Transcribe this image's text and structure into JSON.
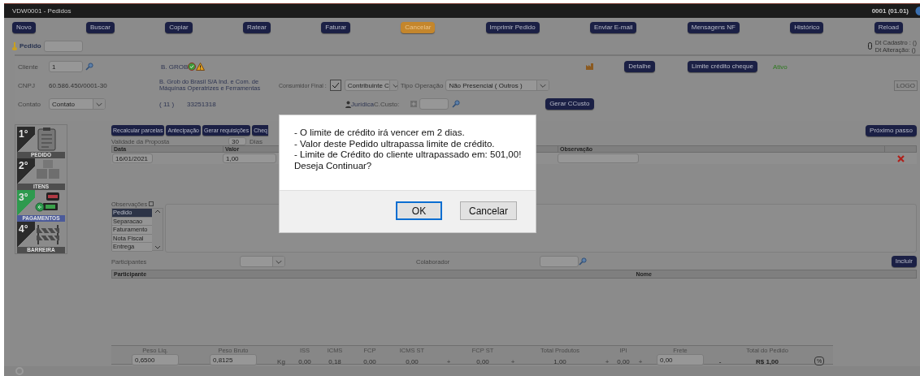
{
  "window": {
    "title": "VDW0001 - Pedidos",
    "version": "0001 (01.01)"
  },
  "toolbar": [
    {
      "label": "Novo",
      "kind": "normal"
    },
    {
      "label": "Buscar",
      "kind": "normal"
    },
    {
      "label": "Copiar",
      "kind": "normal"
    },
    {
      "label": "Ratear",
      "kind": "normal"
    },
    {
      "label": "Faturar",
      "kind": "normal"
    },
    {
      "label": "Cancelar",
      "kind": "warning"
    },
    {
      "label": "Imprimir Pedido",
      "kind": "normal"
    },
    {
      "label": "Enviar E-mail",
      "kind": "normal"
    },
    {
      "label": "Mensagens NF",
      "kind": "normal"
    },
    {
      "label": "Histórico",
      "kind": "normal"
    },
    {
      "label": "Reload",
      "kind": "normal"
    }
  ],
  "order": {
    "label": "Pedido",
    "created": "Dt Cadastro : ()",
    "changed": "Dt Alteração: ()"
  },
  "client": {
    "cliente_label": "Cliente",
    "cliente_value": "1",
    "short_name": "B. GROB",
    "cnpj_label": "CNPJ",
    "cnpj": "60.586.450/0001-30",
    "company_name": "B. Grob do Brasil S/A Ind. e Com. de Máquinas Operatrizes e Ferramentas",
    "contato_label": "Contato",
    "contato_value": "Contato",
    "phone_area": "(  11  )",
    "phone": "33251318",
    "consumidor_label": "Consumidor Final :",
    "consumidor_checked": true,
    "contribuinte": "Contribuinte C",
    "tipo_label": "Tipo Operação",
    "tipo_value": "Não Presencial ( Outros )",
    "person_type": "Jurídica",
    "ccusto_label": "C.Custo:",
    "detail_button": "Detalhe",
    "credit_button": "Limite crédito cheque",
    "status": "Ativo",
    "gerar_button": "Gerar CCusto",
    "logo": "LOGO"
  },
  "steps": [
    {
      "number": "1°",
      "label": "PEDIDO",
      "kind": "clipboard",
      "selected": false
    },
    {
      "number": "2°",
      "label": "ITENS",
      "kind": "boxes",
      "selected": false
    },
    {
      "number": "3°",
      "label": "PAGAMENTOS",
      "kind": "payment",
      "selected": true
    },
    {
      "number": "4°",
      "label": "BARREIRA",
      "kind": "barrier",
      "selected": false
    }
  ],
  "payment_buttons": [
    "Recalcular parcelas",
    "Antecipação",
    "Gerar requisições",
    "Cheq"
  ],
  "next_button": "Próximo passo",
  "validity": {
    "label": "Validade da Proposta",
    "value": "30",
    "unit": "Dias"
  },
  "installments": {
    "columns": [
      "Data",
      "Valor",
      "Observação"
    ],
    "rows": [
      {
        "data": "16/01/2021",
        "valor": "1,00"
      }
    ]
  },
  "observations": {
    "label": "Observações",
    "items": [
      {
        "label": "Pedido",
        "selected": true
      },
      {
        "label": "Separacao",
        "selected": false
      },
      {
        "label": "Faturamento",
        "selected": false
      },
      {
        "label": "Nota Fiscal",
        "selected": false
      },
      {
        "label": "Entrega",
        "selected": false
      }
    ]
  },
  "participants": {
    "label": "Participantes",
    "colaborador_label": "Colaborador",
    "include_button": "Incluir",
    "columns": [
      "Participante",
      "Nome"
    ]
  },
  "totals": [
    {
      "kind": "input",
      "label": "Peso Liq.",
      "value": "0,6500"
    },
    {
      "kind": "input",
      "label": "Peso Bruto",
      "value": "0,8125"
    },
    {
      "kind": "unit",
      "value": "Kg"
    },
    {
      "kind": "text",
      "label": "ISS",
      "value": "0,00"
    },
    {
      "kind": "text",
      "label": "ICMS",
      "value": "0,18"
    },
    {
      "kind": "text",
      "label": "FCP",
      "value": "0,00"
    },
    {
      "kind": "text",
      "label": "ICMS ST",
      "value": "0,00"
    },
    {
      "kind": "operator",
      "value": "+"
    },
    {
      "kind": "text",
      "label": "FCP ST",
      "value": "0,00"
    },
    {
      "kind": "operator",
      "value": "+"
    },
    {
      "kind": "text",
      "label": "Total Produtos",
      "value": "1,00"
    },
    {
      "kind": "operator",
      "value": "+"
    },
    {
      "kind": "text",
      "label": "IPI",
      "value": "0,00"
    },
    {
      "kind": "operator",
      "value": "+"
    },
    {
      "kind": "input",
      "label": "Frete",
      "value": "0,00"
    },
    {
      "kind": "operator",
      "value": "-"
    },
    {
      "kind": "total",
      "label": "Total do Pedido",
      "value": "R$ 1,00"
    },
    {
      "kind": "percent",
      "value": "%"
    }
  ],
  "dialog": {
    "messages": [
      "- O limite de crédito irá vencer em 2 dias.",
      "- Valor deste Pedido ultrapassa limite de crédito.",
      "- Limite de Crédito do cliente ultrapassado em: 501,00!",
      "Deseja Continuar?"
    ],
    "buttons": [
      {
        "label": "OK",
        "selected": true
      },
      {
        "label": "Cancelar",
        "selected": false
      }
    ]
  }
}
